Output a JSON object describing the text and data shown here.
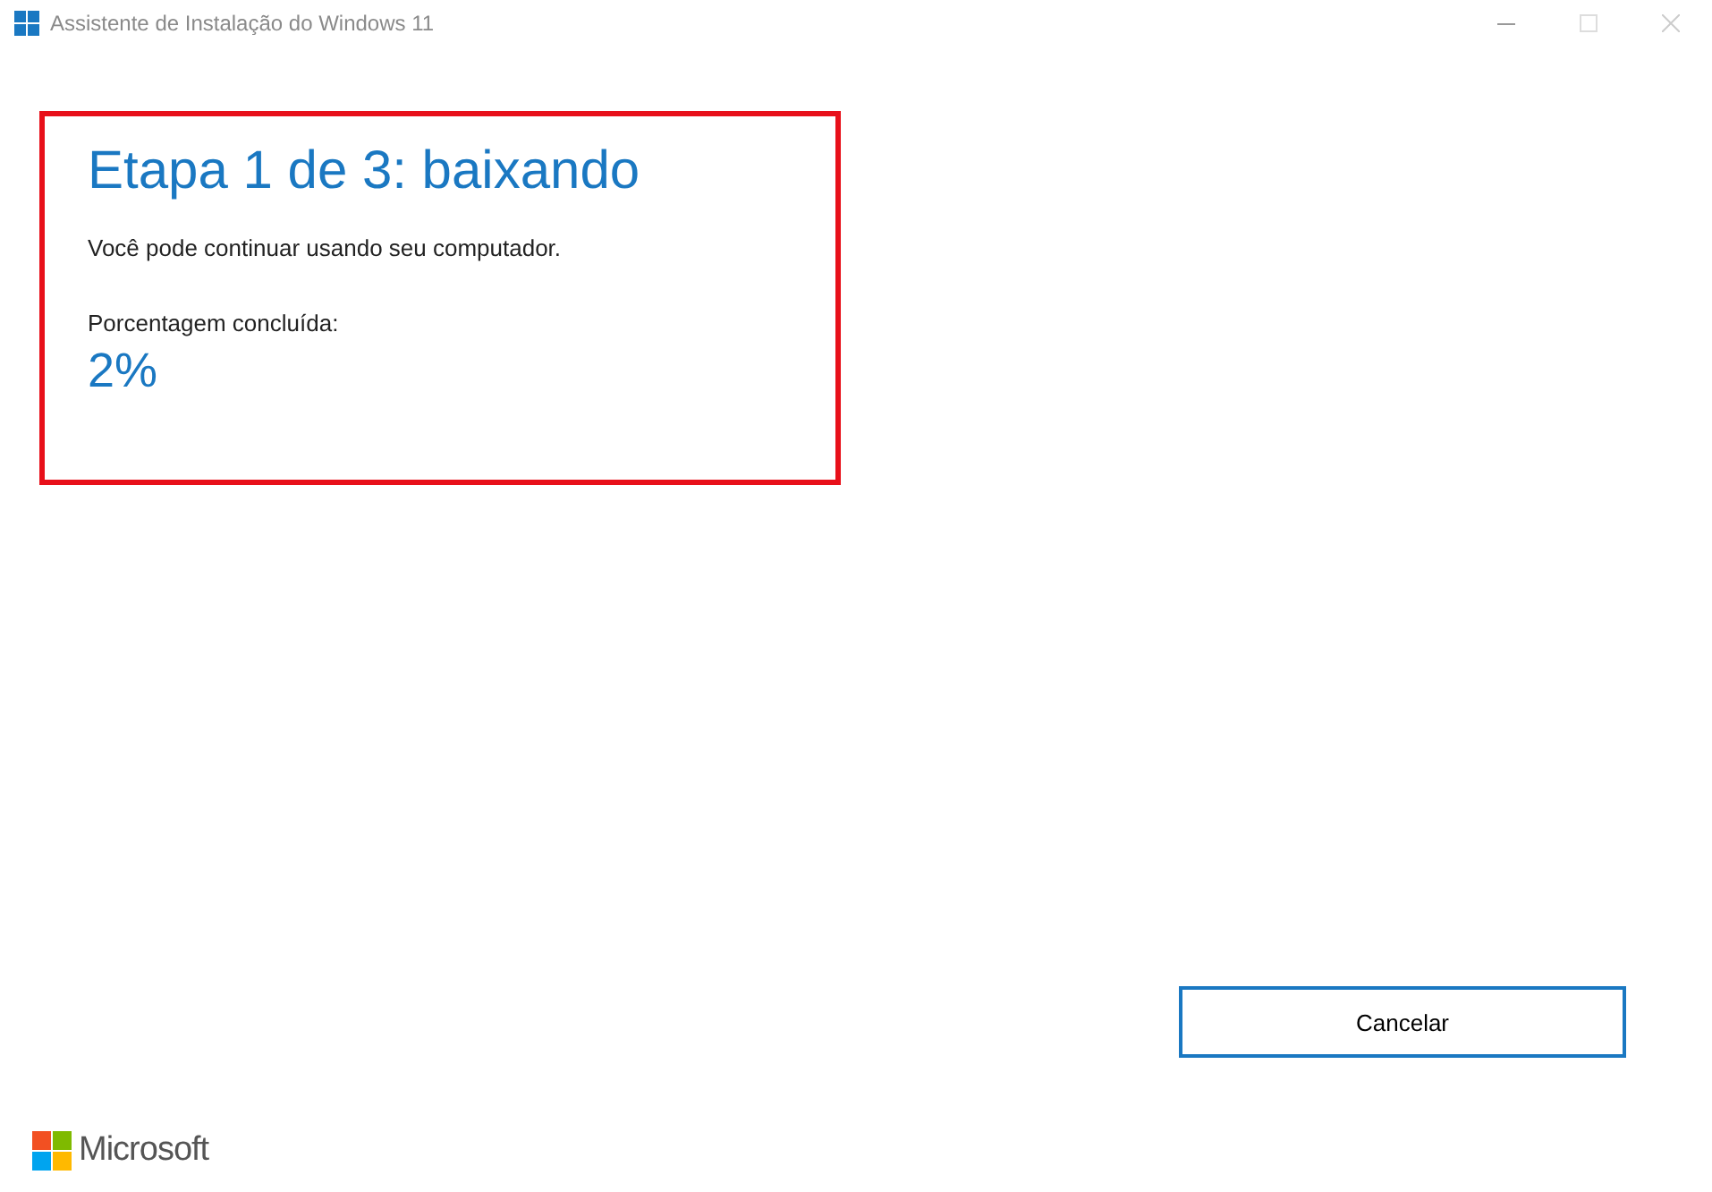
{
  "window": {
    "title": "Assistente de Instalação do Windows 11"
  },
  "heading": "Etapa 1 de 3: baixando",
  "message": "Você pode continuar usando seu computador.",
  "progress_label": "Porcentagem concluída:",
  "progress_value": "2%",
  "buttons": [
    "Cancelar"
  ],
  "footer": {
    "brand": "Microsoft"
  }
}
